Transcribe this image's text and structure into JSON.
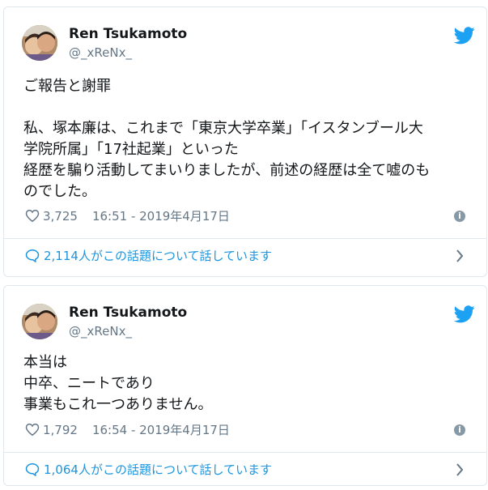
{
  "tweets": [
    {
      "author_name": "Ren Tsukamoto",
      "handle": "@_xReNx_",
      "lines": [
        "ご報告と謝罪",
        "",
        "私、塚本廉は、これまで「東京大学卒業」「イスタンブール大",
        "学院所属」「17社起業」といった",
        "経歴を騙り活動してまいりましたが、前述の経歴は全て嘘のも",
        "のでした。"
      ],
      "likes": "3,725",
      "timestamp": "16:51 - 2019年4月17日",
      "conversation": "2,114人がこの話題について話しています"
    },
    {
      "author_name": "Ren Tsukamoto",
      "handle": "@_xReNx_",
      "lines": [
        "本当は",
        "中卒、ニートであり",
        "事業もこれ一つありません。"
      ],
      "likes": "1,792",
      "timestamp": "16:54 - 2019年4月17日",
      "conversation": "1,064人がこの話題について話しています"
    }
  ],
  "colors": {
    "twitter_blue": "#1da1f2",
    "link_blue": "#1b95e0",
    "muted_gray": "#657786",
    "border": "#e1e8ed"
  },
  "icons": {
    "brand": "twitter-bird-icon",
    "like": "heart-icon",
    "info": "info-icon",
    "reply": "speech-bubble-icon",
    "more": "chevron-right-icon"
  }
}
